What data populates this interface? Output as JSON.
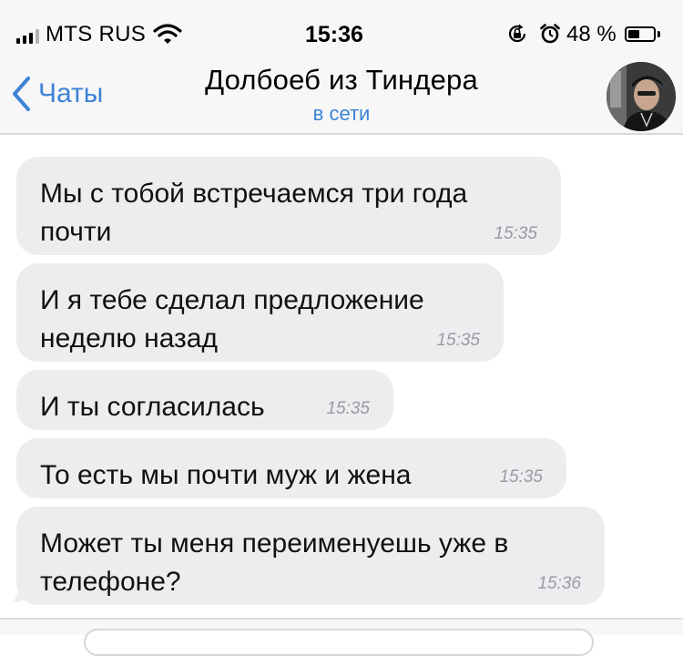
{
  "status_bar": {
    "carrier": "MTS RUS",
    "time": "15:36",
    "battery_percent": "48 %",
    "battery_level": 0.48,
    "icons": [
      "signal-icon",
      "wifi-icon",
      "rotation-lock-icon",
      "alarm-icon",
      "battery-icon"
    ]
  },
  "nav": {
    "back_label": "Чаты",
    "title": "Долбоеб из Тиндера",
    "status": "в сети",
    "accent_color": "#3c83d6"
  },
  "messages": [
    {
      "text": "Мы с тобой встречаемся три года почти",
      "time": "15:35"
    },
    {
      "text": "И я тебе сделал предложение неделю назад",
      "time": "15:35"
    },
    {
      "text": "И ты согласилась",
      "time": "15:35"
    },
    {
      "text": "То есть мы почти муж и жена",
      "time": "15:35"
    },
    {
      "text": "Может ты меня переименуешь уже в телефоне?",
      "time": "15:36"
    }
  ],
  "colors": {
    "bubble": "#ededf0",
    "bar_background": "#f7f7f8",
    "timestamp": "#9a9aa0"
  }
}
